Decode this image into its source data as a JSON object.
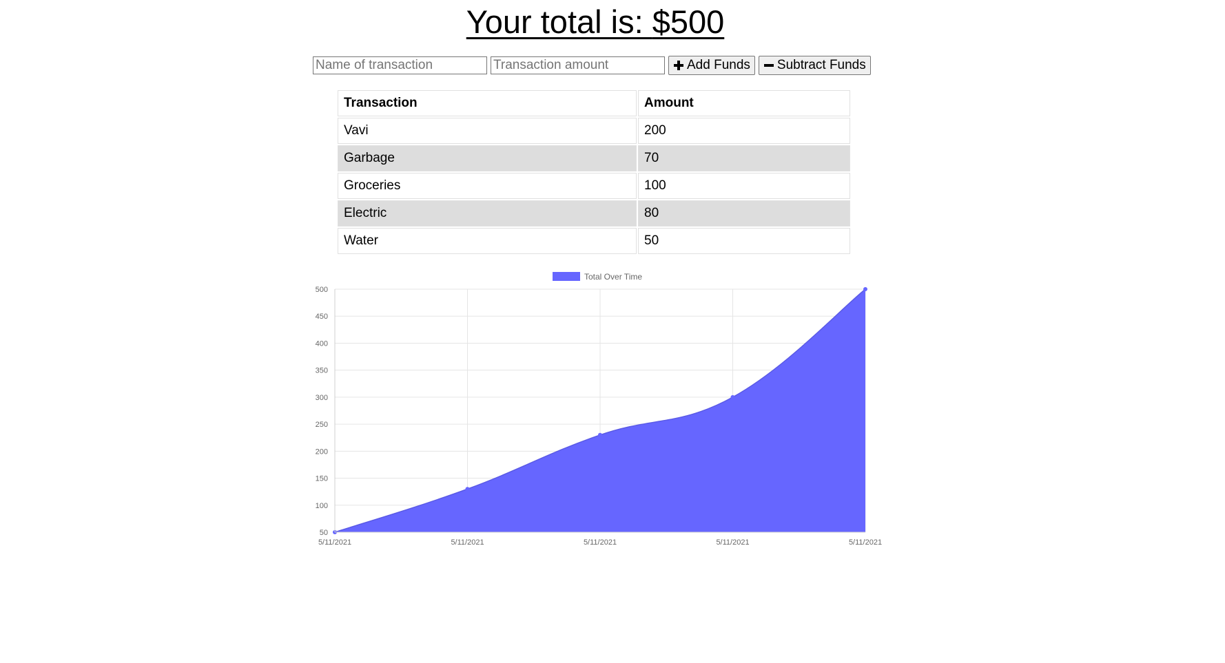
{
  "header": {
    "total_label": "Your total is: ",
    "total_value": "$500"
  },
  "form": {
    "name_placeholder": "Name of transaction",
    "amount_placeholder": "Transaction amount",
    "add_label": "Add Funds",
    "subtract_label": "Subtract Funds",
    "add_icon": "plus-icon",
    "subtract_icon": "minus-icon"
  },
  "table": {
    "headers": [
      "Transaction",
      "Amount"
    ],
    "rows": [
      [
        "Vavi",
        "200"
      ],
      [
        "Garbage",
        "70"
      ],
      [
        "Groceries",
        "100"
      ],
      [
        "Electric",
        "80"
      ],
      [
        "Water",
        "50"
      ]
    ],
    "stripe_color": "#dddddd"
  },
  "chart_data": {
    "type": "area",
    "x": [
      "5/11/2021",
      "5/11/2021",
      "5/11/2021",
      "5/11/2021",
      "5/11/2021"
    ],
    "series": [
      {
        "name": "Total Over Time",
        "values": [
          50,
          130,
          230,
          300,
          500
        ],
        "color": "#6666ff"
      }
    ],
    "ylim": [
      50,
      500
    ],
    "yticks": [
      50,
      100,
      150,
      200,
      250,
      300,
      350,
      400,
      450,
      500
    ],
    "grid": true,
    "legend": "top-center"
  }
}
